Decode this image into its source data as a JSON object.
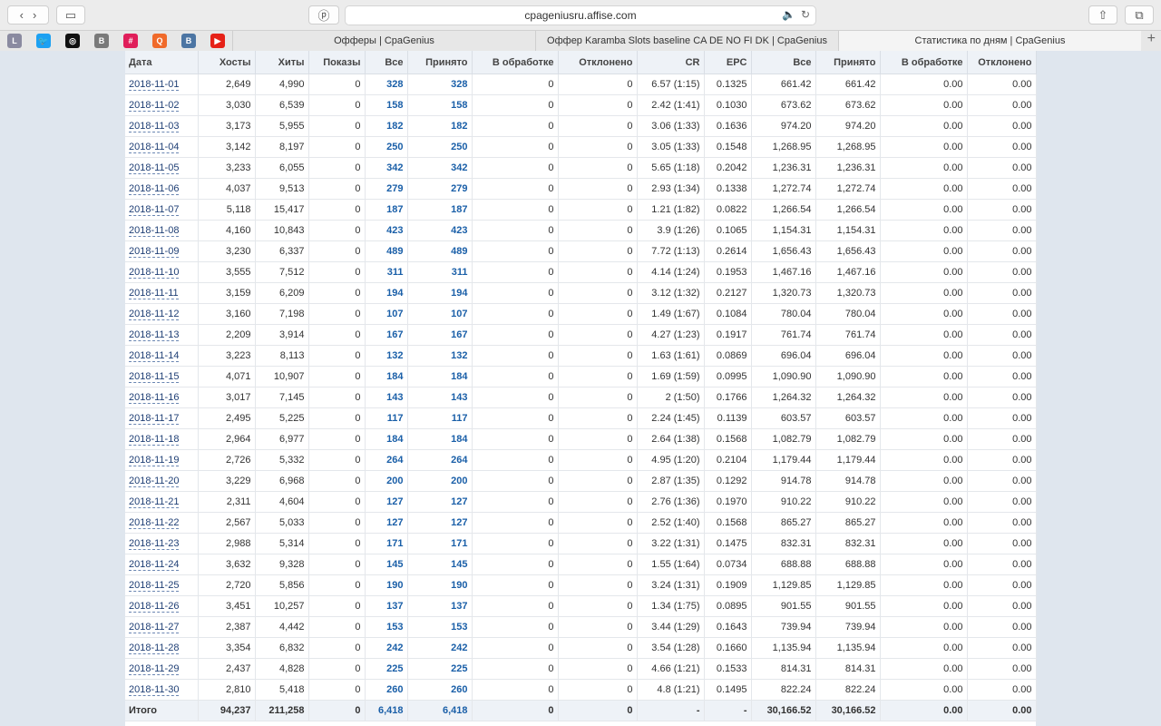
{
  "browser": {
    "url": "cpageniusru.affise.com",
    "tabs": [
      {
        "title": "Офферы | CpaGenius",
        "active": false
      },
      {
        "title": "Оффер Karamba Slots baseline CA DE NO FI DK | CpaGenius",
        "active": false
      },
      {
        "title": "Статистика по дням | CpaGenius",
        "active": true
      }
    ],
    "favorites": [
      {
        "icon": "l-icon",
        "glyph": "L",
        "color": "#8a8aa0"
      },
      {
        "icon": "twitter-icon",
        "glyph": "🐦",
        "color": "#1da1f2"
      },
      {
        "icon": "instagram-icon",
        "glyph": "◎",
        "color": "#111111"
      },
      {
        "icon": "b-icon",
        "glyph": "B",
        "color": "#7a7a7a"
      },
      {
        "icon": "slack-icon",
        "glyph": "#",
        "color": "#e01e5a"
      },
      {
        "icon": "q-icon",
        "glyph": "Q",
        "color": "#f06a2a"
      },
      {
        "icon": "vk-icon",
        "glyph": "В",
        "color": "#4c75a3"
      },
      {
        "icon": "youtube-icon",
        "glyph": "▶",
        "color": "#e62117"
      }
    ]
  },
  "table": {
    "headers": [
      "Дата",
      "Хосты",
      "Хиты",
      "Показы",
      "Все",
      "Принято",
      "В обработке",
      "Отклонено",
      "CR",
      "EPC",
      "Все",
      "Принято",
      "В обработке",
      "Отклонено"
    ],
    "rows": [
      [
        "2018-11-01",
        "2,649",
        "4,990",
        "0",
        "328",
        "328",
        "0",
        "0",
        "6.57 (1:15)",
        "0.1325",
        "661.42",
        "661.42",
        "0.00",
        "0.00"
      ],
      [
        "2018-11-02",
        "3,030",
        "6,539",
        "0",
        "158",
        "158",
        "0",
        "0",
        "2.42 (1:41)",
        "0.1030",
        "673.62",
        "673.62",
        "0.00",
        "0.00"
      ],
      [
        "2018-11-03",
        "3,173",
        "5,955",
        "0",
        "182",
        "182",
        "0",
        "0",
        "3.06 (1:33)",
        "0.1636",
        "974.20",
        "974.20",
        "0.00",
        "0.00"
      ],
      [
        "2018-11-04",
        "3,142",
        "8,197",
        "0",
        "250",
        "250",
        "0",
        "0",
        "3.05 (1:33)",
        "0.1548",
        "1,268.95",
        "1,268.95",
        "0.00",
        "0.00"
      ],
      [
        "2018-11-05",
        "3,233",
        "6,055",
        "0",
        "342",
        "342",
        "0",
        "0",
        "5.65 (1:18)",
        "0.2042",
        "1,236.31",
        "1,236.31",
        "0.00",
        "0.00"
      ],
      [
        "2018-11-06",
        "4,037",
        "9,513",
        "0",
        "279",
        "279",
        "0",
        "0",
        "2.93 (1:34)",
        "0.1338",
        "1,272.74",
        "1,272.74",
        "0.00",
        "0.00"
      ],
      [
        "2018-11-07",
        "5,118",
        "15,417",
        "0",
        "187",
        "187",
        "0",
        "0",
        "1.21 (1:82)",
        "0.0822",
        "1,266.54",
        "1,266.54",
        "0.00",
        "0.00"
      ],
      [
        "2018-11-08",
        "4,160",
        "10,843",
        "0",
        "423",
        "423",
        "0",
        "0",
        "3.9 (1:26)",
        "0.1065",
        "1,154.31",
        "1,154.31",
        "0.00",
        "0.00"
      ],
      [
        "2018-11-09",
        "3,230",
        "6,337",
        "0",
        "489",
        "489",
        "0",
        "0",
        "7.72 (1:13)",
        "0.2614",
        "1,656.43",
        "1,656.43",
        "0.00",
        "0.00"
      ],
      [
        "2018-11-10",
        "3,555",
        "7,512",
        "0",
        "311",
        "311",
        "0",
        "0",
        "4.14 (1:24)",
        "0.1953",
        "1,467.16",
        "1,467.16",
        "0.00",
        "0.00"
      ],
      [
        "2018-11-11",
        "3,159",
        "6,209",
        "0",
        "194",
        "194",
        "0",
        "0",
        "3.12 (1:32)",
        "0.2127",
        "1,320.73",
        "1,320.73",
        "0.00",
        "0.00"
      ],
      [
        "2018-11-12",
        "3,160",
        "7,198",
        "0",
        "107",
        "107",
        "0",
        "0",
        "1.49 (1:67)",
        "0.1084",
        "780.04",
        "780.04",
        "0.00",
        "0.00"
      ],
      [
        "2018-11-13",
        "2,209",
        "3,914",
        "0",
        "167",
        "167",
        "0",
        "0",
        "4.27 (1:23)",
        "0.1917",
        "761.74",
        "761.74",
        "0.00",
        "0.00"
      ],
      [
        "2018-11-14",
        "3,223",
        "8,113",
        "0",
        "132",
        "132",
        "0",
        "0",
        "1.63 (1:61)",
        "0.0869",
        "696.04",
        "696.04",
        "0.00",
        "0.00"
      ],
      [
        "2018-11-15",
        "4,071",
        "10,907",
        "0",
        "184",
        "184",
        "0",
        "0",
        "1.69 (1:59)",
        "0.0995",
        "1,090.90",
        "1,090.90",
        "0.00",
        "0.00"
      ],
      [
        "2018-11-16",
        "3,017",
        "7,145",
        "0",
        "143",
        "143",
        "0",
        "0",
        "2 (1:50)",
        "0.1766",
        "1,264.32",
        "1,264.32",
        "0.00",
        "0.00"
      ],
      [
        "2018-11-17",
        "2,495",
        "5,225",
        "0",
        "117",
        "117",
        "0",
        "0",
        "2.24 (1:45)",
        "0.1139",
        "603.57",
        "603.57",
        "0.00",
        "0.00"
      ],
      [
        "2018-11-18",
        "2,964",
        "6,977",
        "0",
        "184",
        "184",
        "0",
        "0",
        "2.64 (1:38)",
        "0.1568",
        "1,082.79",
        "1,082.79",
        "0.00",
        "0.00"
      ],
      [
        "2018-11-19",
        "2,726",
        "5,332",
        "0",
        "264",
        "264",
        "0",
        "0",
        "4.95 (1:20)",
        "0.2104",
        "1,179.44",
        "1,179.44",
        "0.00",
        "0.00"
      ],
      [
        "2018-11-20",
        "3,229",
        "6,968",
        "0",
        "200",
        "200",
        "0",
        "0",
        "2.87 (1:35)",
        "0.1292",
        "914.78",
        "914.78",
        "0.00",
        "0.00"
      ],
      [
        "2018-11-21",
        "2,311",
        "4,604",
        "0",
        "127",
        "127",
        "0",
        "0",
        "2.76 (1:36)",
        "0.1970",
        "910.22",
        "910.22",
        "0.00",
        "0.00"
      ],
      [
        "2018-11-22",
        "2,567",
        "5,033",
        "0",
        "127",
        "127",
        "0",
        "0",
        "2.52 (1:40)",
        "0.1568",
        "865.27",
        "865.27",
        "0.00",
        "0.00"
      ],
      [
        "2018-11-23",
        "2,988",
        "5,314",
        "0",
        "171",
        "171",
        "0",
        "0",
        "3.22 (1:31)",
        "0.1475",
        "832.31",
        "832.31",
        "0.00",
        "0.00"
      ],
      [
        "2018-11-24",
        "3,632",
        "9,328",
        "0",
        "145",
        "145",
        "0",
        "0",
        "1.55 (1:64)",
        "0.0734",
        "688.88",
        "688.88",
        "0.00",
        "0.00"
      ],
      [
        "2018-11-25",
        "2,720",
        "5,856",
        "0",
        "190",
        "190",
        "0",
        "0",
        "3.24 (1:31)",
        "0.1909",
        "1,129.85",
        "1,129.85",
        "0.00",
        "0.00"
      ],
      [
        "2018-11-26",
        "3,451",
        "10,257",
        "0",
        "137",
        "137",
        "0",
        "0",
        "1.34 (1:75)",
        "0.0895",
        "901.55",
        "901.55",
        "0.00",
        "0.00"
      ],
      [
        "2018-11-27",
        "2,387",
        "4,442",
        "0",
        "153",
        "153",
        "0",
        "0",
        "3.44 (1:29)",
        "0.1643",
        "739.94",
        "739.94",
        "0.00",
        "0.00"
      ],
      [
        "2018-11-28",
        "3,354",
        "6,832",
        "0",
        "242",
        "242",
        "0",
        "0",
        "3.54 (1:28)",
        "0.1660",
        "1,135.94",
        "1,135.94",
        "0.00",
        "0.00"
      ],
      [
        "2018-11-29",
        "2,437",
        "4,828",
        "0",
        "225",
        "225",
        "0",
        "0",
        "4.66 (1:21)",
        "0.1533",
        "814.31",
        "814.31",
        "0.00",
        "0.00"
      ],
      [
        "2018-11-30",
        "2,810",
        "5,418",
        "0",
        "260",
        "260",
        "0",
        "0",
        "4.8 (1:21)",
        "0.1495",
        "822.24",
        "822.24",
        "0.00",
        "0.00"
      ]
    ],
    "total": [
      "Итого",
      "94,237",
      "211,258",
      "0",
      "6,418",
      "6,418",
      "0",
      "0",
      "-",
      "-",
      "30,166.52",
      "30,166.52",
      "0.00",
      "0.00"
    ]
  }
}
